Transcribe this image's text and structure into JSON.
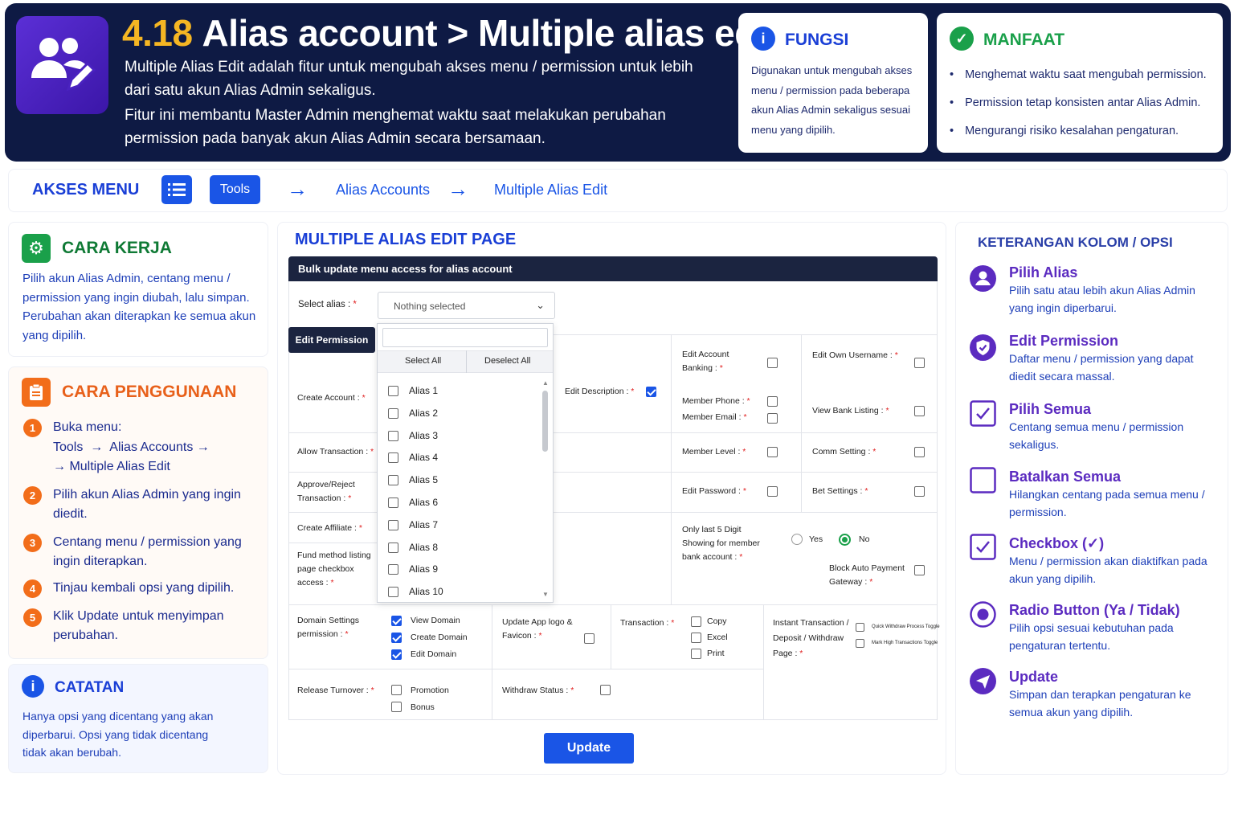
{
  "header": {
    "number": "4.18",
    "title": "Alias account > Multiple alias edit",
    "desc1": "Multiple Alias Edit adalah fitur untuk mengubah akses menu / permission untuk lebih dari satu akun Alias Admin sekaligus.",
    "desc2": "Fitur ini membantu Master Admin menghemat waktu saat melakukan perubahan permission pada banyak akun Alias Admin secara bersamaan."
  },
  "fungsi": {
    "title": "FUNGSI",
    "text": "Digunakan untuk mengubah akses menu / permission pada beberapa akun Alias Admin sekaligus sesuai menu yang dipilih."
  },
  "manfaat": {
    "title": "MANFAAT",
    "items": [
      "Menghemat waktu saat mengubah permission.",
      "Permission tetap konsisten antar Alias Admin.",
      "Mengurangi risiko kesalahan pengaturan."
    ]
  },
  "akses": {
    "label": "AKSES MENU",
    "tools": "Tools",
    "crumb1": "Alias Accounts",
    "crumb2": "Multiple Alias Edit"
  },
  "cara_kerja": {
    "title": "CARA KERJA",
    "text": "Pilih akun Alias Admin, centang menu / permission yang ingin diubah, lalu simpan. Perubahan akan diterapkan ke semua akun yang dipilih."
  },
  "cara_penggunaan": {
    "title": "CARA PENGGUNAAN",
    "steps": [
      {
        "n": "1",
        "text": "Buka menu:"
      },
      {
        "n": "2",
        "text": "Pilih akun Alias Admin yang ingin diedit."
      },
      {
        "n": "3",
        "text": "Centang menu / permission yang ingin diterapkan."
      },
      {
        "n": "4",
        "text": "Tinjau kembali opsi yang dipilih."
      },
      {
        "n": "5",
        "text": "Klik Update untuk menyimpan perubahan."
      }
    ],
    "path_a": "Tools",
    "path_b": "Alias Accounts",
    "path_c": "Multiple Alias Edit"
  },
  "catatan": {
    "title": "CATATAN",
    "text": "Hanya opsi yang dicentang yang akan diperbarui. Opsi yang tidak dicentang tidak akan berubah."
  },
  "form": {
    "page_title": "MULTIPLE ALIAS EDIT PAGE",
    "bar": "Bulk update menu access for alias account",
    "select_alias_label": "Select alias :",
    "select_placeholder": "Nothing selected",
    "edit_permission": "Edit Permission",
    "select_all": "Select All",
    "deselect_all": "Deselect All",
    "aliases": [
      "Alias 1",
      "Alias 2",
      "Alias 3",
      "Alias 4",
      "Alias 5",
      "Alias 6",
      "Alias 7",
      "Alias 8",
      "Alias 9",
      "Alias 10"
    ],
    "labels": {
      "create_account": "Create Account :",
      "allow_transaction": "Allow Transaction :",
      "approve_reject": "Approve/Reject Transaction :",
      "create_affiliate": "Create Affiliate :",
      "fund_method": "Fund method listing page checkbox access :",
      "edit_description": "Edit Description :",
      "edit_account_banking": "Edit Account Banking :",
      "member_phone": "Member Phone :",
      "member_email": "Member Email :",
      "member_level": "Member Level :",
      "edit_password": "Edit Password :",
      "only_last5": "Only last 5 Digit Showing for member bank account :",
      "edit_own_username": "Edit Own Username :",
      "view_bank_listing": "View Bank Listing :",
      "comm_setting": "Comm Setting :",
      "bet_settings": "Bet Settings :",
      "block_auto_payment": "Block Auto Payment Gateway :",
      "yes": "Yes",
      "no": "No",
      "domain_settings": "Domain Settings permission :",
      "view_domain": "View Domain",
      "create_domain": "Create Domain",
      "edit_domain": "Edit Domain",
      "update_app_logo": "Update App logo & Favicon :",
      "transaction": "Transaction :",
      "copy": "Copy",
      "excel": "Excel",
      "print": "Print",
      "instant_transaction": "Instant Transaction / Deposit / Withdraw Page :",
      "quick_withdraw": "Quick Withdraw Process Toggle",
      "mark_high": "Mark High Transactions Toggle",
      "release_turnover": "Release Turnover :",
      "promotion": "Promotion",
      "bonus": "Bonus",
      "withdraw_status": "Withdraw Status :"
    },
    "update": "Update"
  },
  "keterangan": {
    "title": "KETERANGAN KOLOM / OPSI",
    "items": [
      {
        "title": "Pilih Alias",
        "text": "Pilih satu atau lebih akun Alias Admin yang ingin diperbarui."
      },
      {
        "title": "Edit Permission",
        "text": "Daftar menu / permission yang dapat diedit secara massal."
      },
      {
        "title": "Pilih Semua",
        "text": "Centang semua menu / permission sekaligus."
      },
      {
        "title": "Batalkan Semua",
        "text": "Hilangkan centang pada semua menu / permission."
      },
      {
        "title": "Checkbox (✓)",
        "text": "Menu / permission akan diaktifkan pada akun yang dipilih."
      },
      {
        "title": "Radio Button (Ya / Tidak)",
        "text": "Pilih opsi sesuai kebutuhan pada pengaturan tertentu."
      },
      {
        "title": "Update",
        "text": "Simpan dan terapkan pengaturan ke semua akun yang dipilih."
      }
    ]
  },
  "colors": {
    "navy": "#0e1a44",
    "blue": "#1a55e6",
    "purple": "#5b2bc0",
    "orange": "#f26d1a",
    "green": "#1aa04a",
    "gold": "#f5b623"
  }
}
